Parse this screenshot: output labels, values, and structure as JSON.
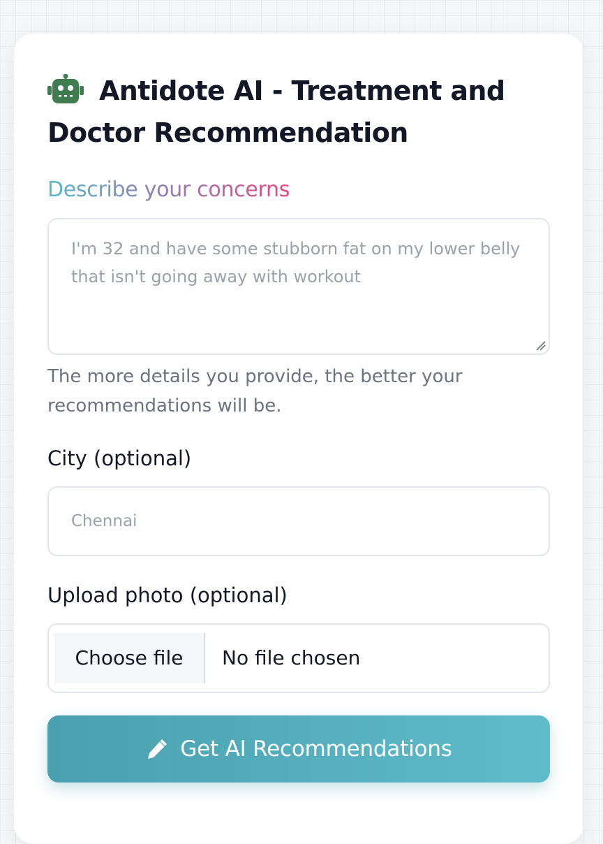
{
  "header": {
    "icon": "robot-icon",
    "title": "Antidote AI - Treatment and Doctor Recommendation"
  },
  "concerns": {
    "label": "Describe your concerns",
    "value": "",
    "placeholder": "I'm 32 and have some stubborn fat on my lower belly that isn't going away with workout",
    "help": "The more details you provide, the better your recommendations will be."
  },
  "city": {
    "label": "City (optional)",
    "value": "",
    "placeholder": "Chennai"
  },
  "photo": {
    "label": "Upload photo (optional)",
    "button_label": "Choose file",
    "status": "No file chosen"
  },
  "submit": {
    "icon": "pencil-icon",
    "label": "Get AI Recommendations"
  },
  "colors": {
    "accent_start": "#4aa0ae",
    "accent_end": "#5fbccb",
    "robot_green": "#3f7c50",
    "label_gradient": [
      "#58b8c8",
      "#8d80b8",
      "#e4487f"
    ]
  }
}
